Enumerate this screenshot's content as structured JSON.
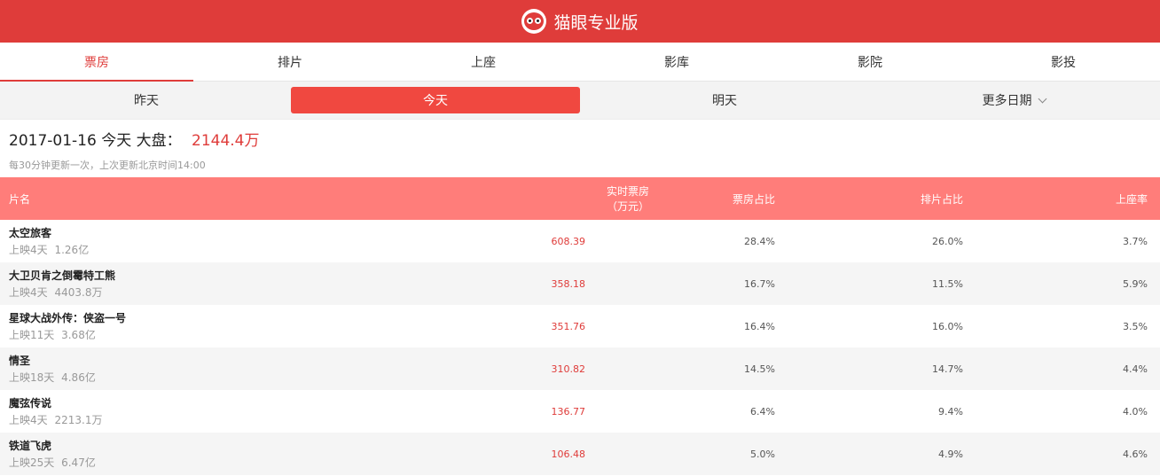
{
  "header": {
    "brand": "猫眼专业版",
    "logo_icon": "cat-eye-logo-icon",
    "brand_color": "#df3c3a"
  },
  "tabs": [
    {
      "label": "票房",
      "active": true
    },
    {
      "label": "排片",
      "active": false
    },
    {
      "label": "上座",
      "active": false
    },
    {
      "label": "影库",
      "active": false
    },
    {
      "label": "影院",
      "active": false
    },
    {
      "label": "影投",
      "active": false
    }
  ],
  "dates": [
    {
      "label": "昨天",
      "active": false
    },
    {
      "label": "今天",
      "active": true
    },
    {
      "label": "明天",
      "active": false
    },
    {
      "label": "更多日期",
      "active": false
    }
  ],
  "summary": {
    "date": "2017-01-16",
    "day": "今天",
    "label": "大盘：",
    "total": "2144.4万",
    "note": "每30分钟更新一次，上次更新北京时间14:00"
  },
  "table": {
    "headers": {
      "name": "片名",
      "realtime_line1": "实时票房",
      "realtime_line2": "（万元）",
      "box_share": "票房占比",
      "schedule_share": "排片占比",
      "attendance": "上座率"
    },
    "rows": [
      {
        "name": "太空旅客",
        "days": "上映4天",
        "cum": "1.26亿",
        "realtime": "608.39",
        "box_share": "28.4%",
        "schedule_share": "26.0%",
        "attendance": "3.7%"
      },
      {
        "name": "大卫贝肯之倒霉特工熊",
        "days": "上映4天",
        "cum": "4403.8万",
        "realtime": "358.18",
        "box_share": "16.7%",
        "schedule_share": "11.5%",
        "attendance": "5.9%"
      },
      {
        "name": "星球大战外传：侠盗一号",
        "days": "上映11天",
        "cum": "3.68亿",
        "realtime": "351.76",
        "box_share": "16.4%",
        "schedule_share": "16.0%",
        "attendance": "3.5%"
      },
      {
        "name": "情圣",
        "days": "上映18天",
        "cum": "4.86亿",
        "realtime": "310.82",
        "box_share": "14.5%",
        "schedule_share": "14.7%",
        "attendance": "4.4%"
      },
      {
        "name": "魔弦传说",
        "days": "上映4天",
        "cum": "2213.1万",
        "realtime": "136.77",
        "box_share": "6.4%",
        "schedule_share": "9.4%",
        "attendance": "4.0%"
      },
      {
        "name": "铁道飞虎",
        "days": "上映25天",
        "cum": "6.47亿",
        "realtime": "106.48",
        "box_share": "5.0%",
        "schedule_share": "4.9%",
        "attendance": "4.6%"
      }
    ]
  }
}
